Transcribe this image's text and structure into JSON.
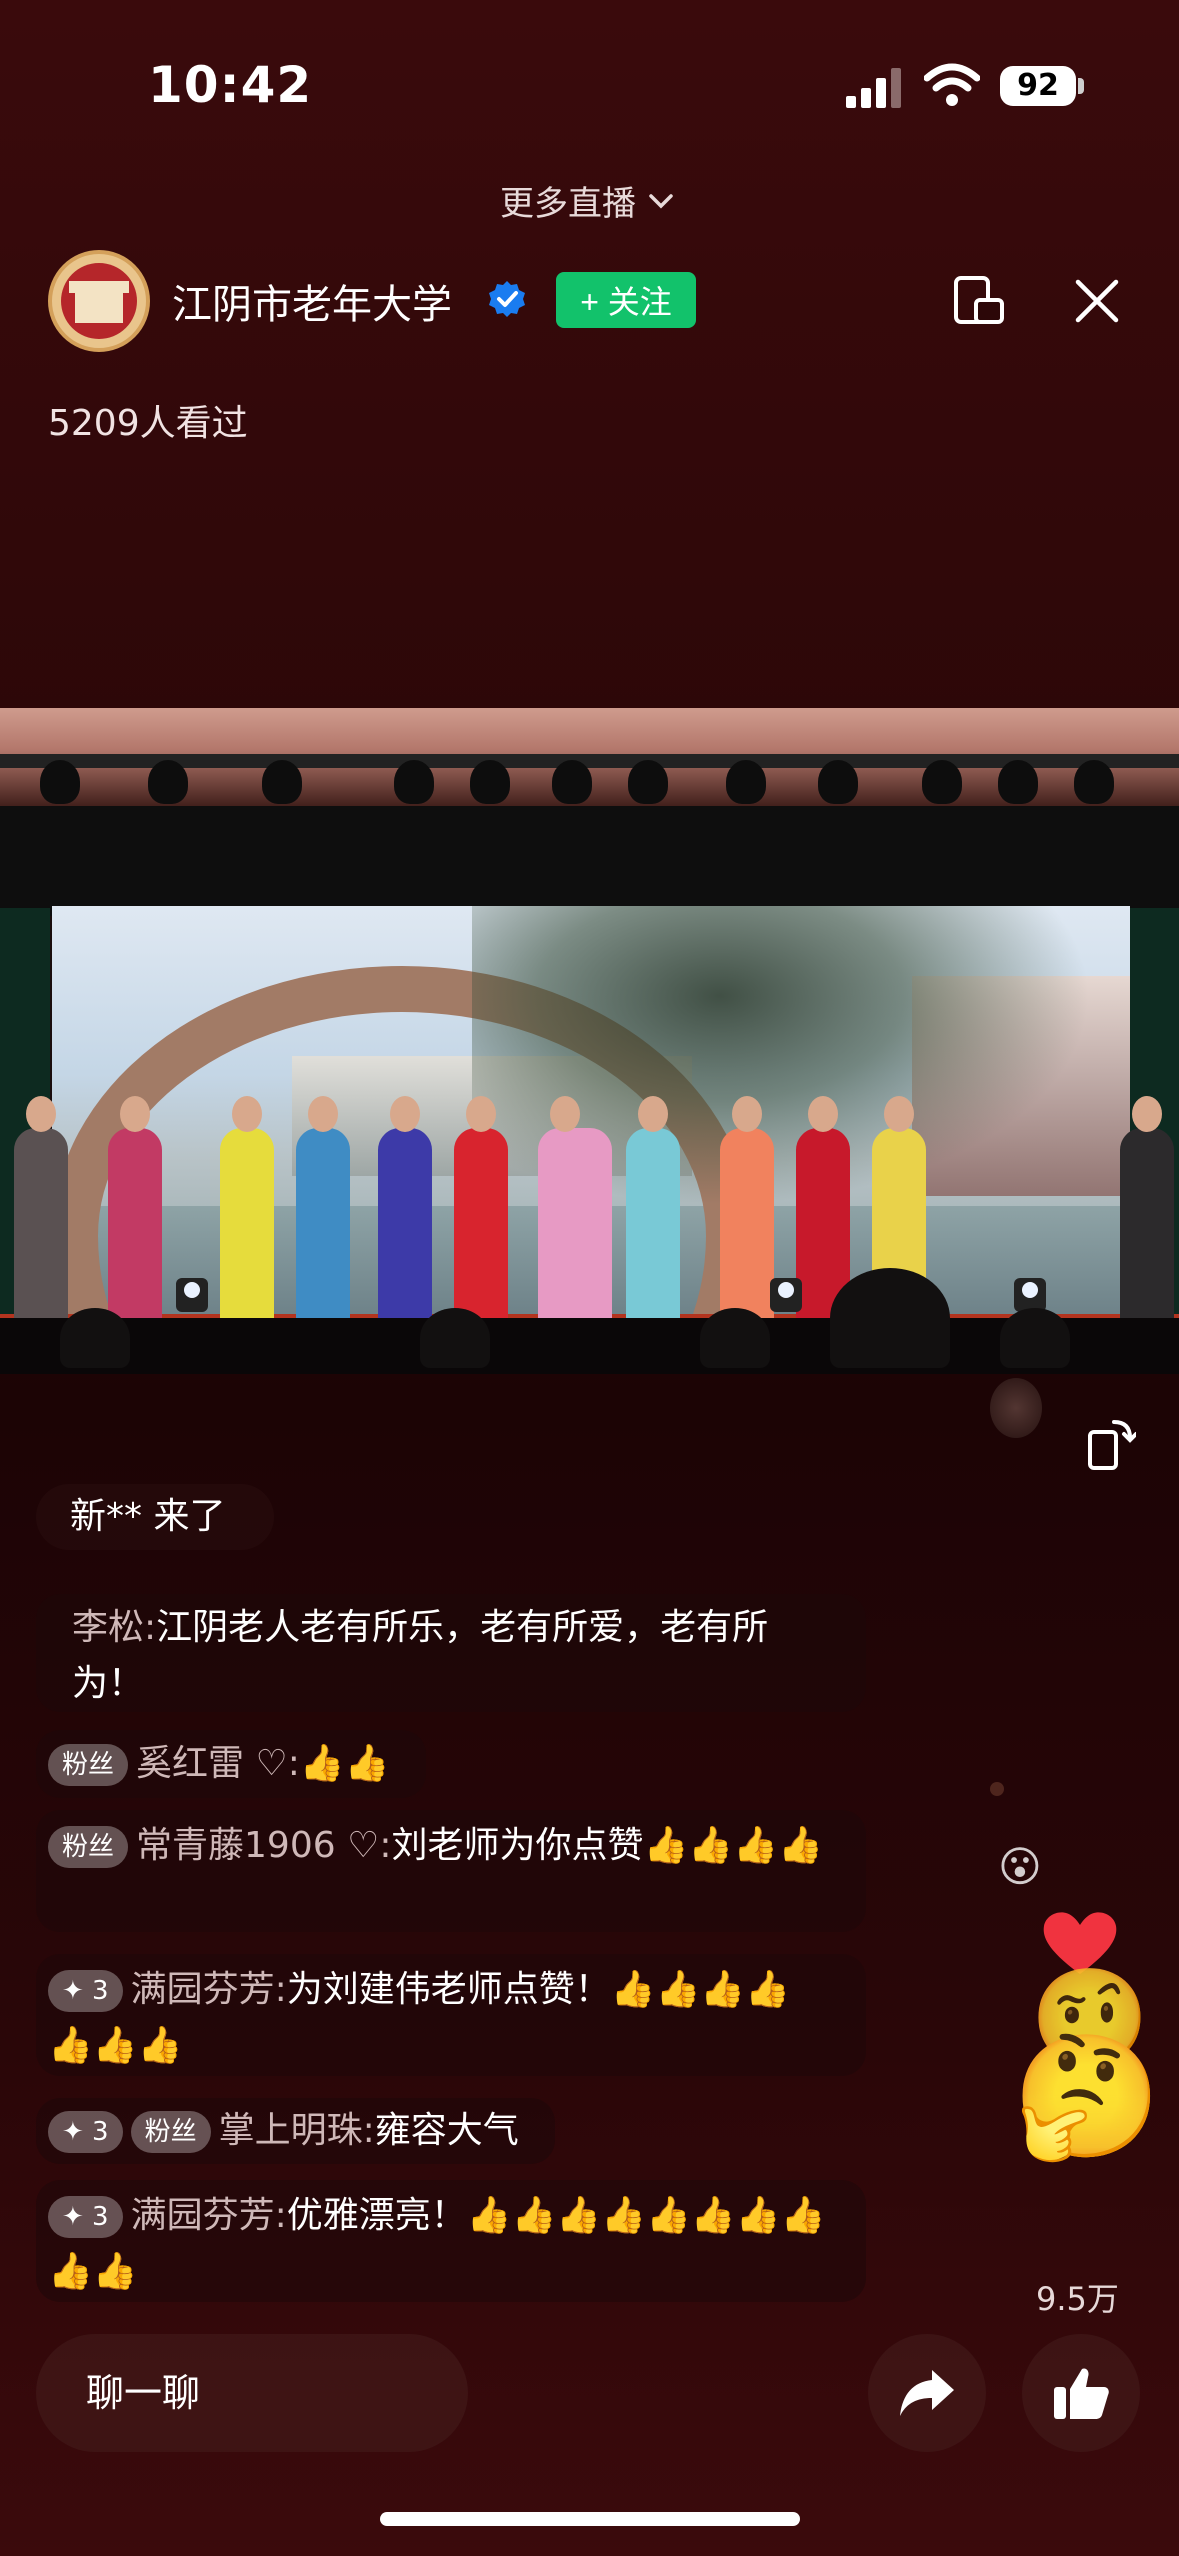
{
  "status_bar": {
    "time": "10:42",
    "battery": "92"
  },
  "header": {
    "more_live": "更多直播",
    "account_name": "江阴市老年大学",
    "follow_label": "+ 关注",
    "viewers": "5209人看过"
  },
  "chat": {
    "welcome": "新** 来了",
    "messages": [
      {
        "name": "李松",
        "text": "江阴老人老有所乐，老有所爱，老有所为！"
      },
      {
        "badges": [
          "粉丝"
        ],
        "name": "奚红雷",
        "text": "👍👍"
      },
      {
        "badges": [
          "粉丝"
        ],
        "name": "常青藤1906",
        "text": "刘老师为你点赞👍👍👍👍"
      },
      {
        "badges": [
          "✦ 3"
        ],
        "name": "满园芬芳",
        "text": "为刘建伟老师点赞！👍👍👍👍👍👍👍"
      },
      {
        "badges": [
          "✦ 3",
          "粉丝"
        ],
        "name": "掌上明珠",
        "text": "雍容大气"
      },
      {
        "badges": [
          "✦ 3"
        ],
        "name": "满园芬芳",
        "text": "优雅漂亮！👍👍👍👍👍👍👍👍👍👍"
      }
    ]
  },
  "bottom_bar": {
    "chat_placeholder": "聊一聊",
    "like_count": "9.5万"
  },
  "colors": {
    "follow": "#12c26b",
    "verified": "#1a7cf0"
  },
  "icons": [
    "signal-icon",
    "wifi-icon",
    "battery-icon",
    "chevron-down-icon",
    "verified-icon",
    "cast-icon",
    "close-icon",
    "rotate-screen-icon",
    "share-icon",
    "like-icon",
    "heart-icon"
  ]
}
